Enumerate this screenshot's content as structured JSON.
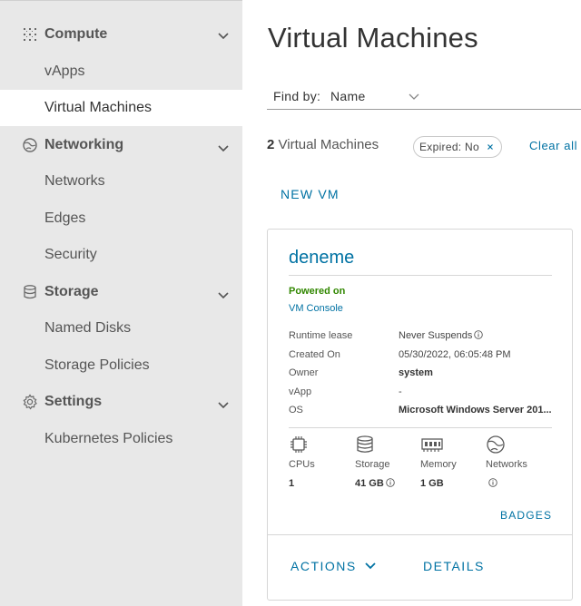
{
  "sidebar": {
    "groups": [
      {
        "label": "Compute",
        "icon": "compute-grid-icon",
        "items": [
          "vApps",
          "Virtual Machines"
        ]
      },
      {
        "label": "Networking",
        "icon": "networking-globe-icon",
        "items": [
          "Networks",
          "Edges",
          "Security"
        ]
      },
      {
        "label": "Storage",
        "icon": "storage-database-icon",
        "items": [
          "Named Disks",
          "Storage Policies"
        ]
      },
      {
        "label": "Settings",
        "icon": "settings-gear-icon",
        "items": [
          "Kubernetes Policies"
        ]
      }
    ],
    "active_item": "Virtual Machines"
  },
  "main": {
    "title": "Virtual Machines",
    "find_by": {
      "label": "Find by:",
      "value": "Name"
    },
    "count_number": "2",
    "count_text": "Virtual Machines",
    "filter_chip": "Expired: No",
    "clear_all": "Clear all",
    "new_vm": "NEW VM"
  },
  "card": {
    "name": "deneme",
    "status": "Powered on",
    "status_color": "#318700",
    "console_link": "VM Console",
    "properties": [
      {
        "key": "Runtime lease",
        "value": "Never Suspends"
      },
      {
        "key": "Created On",
        "value": "05/30/2022, 06:05:48 PM"
      },
      {
        "key": "Owner",
        "value": "system"
      },
      {
        "key": "vApp",
        "value": "-"
      },
      {
        "key": "OS",
        "value": "Microsoft Windows Server 201..."
      }
    ],
    "resources": [
      {
        "label": "CPUs",
        "value": "1",
        "icon": "cpu-chip-icon"
      },
      {
        "label": "Storage",
        "value": "41 GB",
        "icon": "storage-database-icon"
      },
      {
        "label": "Memory",
        "value": "1 GB",
        "icon": "memory-module-icon"
      },
      {
        "label": "Networks",
        "value": "",
        "icon": "networking-globe-icon"
      }
    ],
    "badges": "BADGES",
    "actions": "ACTIONS",
    "details": "DETAILS"
  },
  "colors": {
    "link": "#0072a3",
    "sidebar_bg": "#e8e8e8",
    "active_bg": "#ffffff"
  }
}
